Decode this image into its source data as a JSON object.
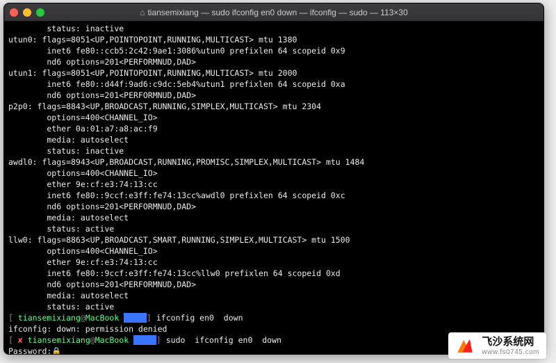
{
  "window": {
    "title": "tiansemixiang — sudo ifconfig en0 down — ifconfig — sudo — 113×30"
  },
  "output": [
    "        status: inactive",
    "utun0: flags=8051<UP,POINTOPOINT,RUNNING,MULTICAST> mtu 1380",
    "        inet6 fe80::ccb5:2c42:9ae1:3086%utun0 prefixlen 64 scopeid 0x9",
    "        nd6 options=201<PERFORMNUD,DAD>",
    "utun1: flags=8051<UP,POINTOPOINT,RUNNING,MULTICAST> mtu 2000",
    "        inet6 fe80::d44f:9ad6:c9dc:5eb4%utun1 prefixlen 64 scopeid 0xa",
    "        nd6 options=201<PERFORMNUD,DAD>",
    "p2p0: flags=8843<UP,BROADCAST,RUNNING,SIMPLEX,MULTICAST> mtu 2304",
    "        options=400<CHANNEL_IO>",
    "        ether 0a:01:a7:a8:ac:f9",
    "        media: autoselect",
    "        status: inactive",
    "awdl0: flags=8943<UP,BROADCAST,RUNNING,PROMISC,SIMPLEX,MULTICAST> mtu 1484",
    "        options=400<CHANNEL_IO>",
    "        ether 9e:cf:e3:74:13:cc",
    "        inet6 fe80::9ccf:e3ff:fe74:13cc%awdl0 prefixlen 64 scopeid 0xc",
    "        nd6 options=201<PERFORMNUD,DAD>",
    "        media: autoselect",
    "        status: active",
    "llw0: flags=8863<UP,BROADCAST,SMART,RUNNING,SIMPLEX,MULTICAST> mtu 1500",
    "        options=400<CHANNEL_IO>",
    "        ether 9e:cf:e3:74:13:cc",
    "        inet6 fe80::9ccf:e3ff:fe74:13cc%llw0 prefixlen 64 scopeid 0xd",
    "        nd6 options=201<PERFORMNUD,DAD>",
    "        media: autoselect",
    "        status: active"
  ],
  "prompts": [
    {
      "user": "tiansemixiang",
      "host": "MacBook",
      "cmd": "ifconfig en0  down",
      "err": false
    }
  ],
  "error_line": "ifconfig: down: permission denied",
  "prompt2": {
    "user": "tiansemixiang",
    "host": "MacBook",
    "cmd": "sudo  ifconfig en0  down",
    "err": true
  },
  "password_label": "Password:",
  "watermark": {
    "cn": "飞沙系统网",
    "en": "www.fs0745.com"
  }
}
